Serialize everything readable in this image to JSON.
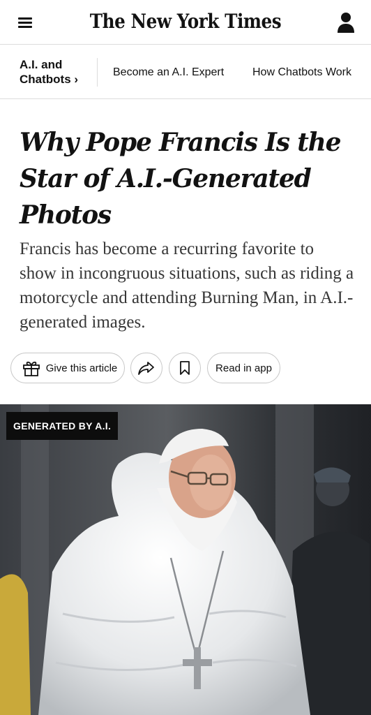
{
  "header": {
    "logo_text": "The New York Times",
    "menu_icon": "hamburger-menu-icon",
    "account_icon": "account-icon"
  },
  "section_nav": {
    "title": "A.I. and Chatbots ›",
    "links": [
      {
        "label": "Become an A.I. Expert"
      },
      {
        "label": "How Chatbots Work"
      }
    ]
  },
  "article": {
    "headline": "Why Pope Francis Is the Star of A.I.-Generated Photos",
    "summary": "Francis has become a recurring favorite to show in incongruous situations, such as riding a motorcycle and attending Burning Man, in A.I.-generated images."
  },
  "actions": {
    "gift_label": "Give this article",
    "gift_icon": "gift-icon",
    "share_icon": "share-icon",
    "bookmark_icon": "bookmark-icon",
    "read_in_app_label": "Read in app"
  },
  "hero": {
    "badge": "GENERATED BY A.I."
  }
}
